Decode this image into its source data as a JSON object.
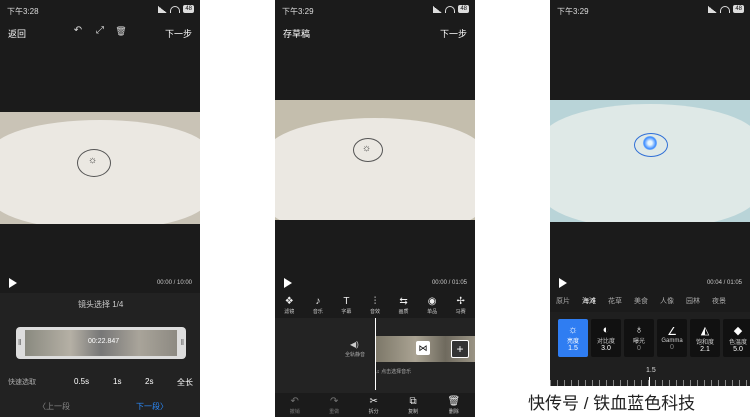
{
  "status": {
    "time1": "下午3:28",
    "time2": "下午3:29",
    "time3": "下午3:29",
    "battery": "48"
  },
  "p1": {
    "back": "返回",
    "next": "下一步",
    "undo_icon": "↶",
    "expand_icon": "⤢",
    "trash_icon": "🗑",
    "timecode": "00:00 / 10:00",
    "clip_label": "镜头选择 1/4",
    "overlay_time": "00:22.847",
    "quick_label": "快速选取",
    "durations": [
      "0.5s",
      "1s",
      "2s",
      "全长"
    ],
    "prev": "上一段",
    "nextseg": "下一段"
  },
  "p2": {
    "draft": "存草稿",
    "next": "下一步",
    "timecode": "00:00 / 01:05",
    "tools": [
      {
        "icon": "filter-icon",
        "glyph": "❖",
        "label": "滤镜"
      },
      {
        "icon": "music-icon",
        "glyph": "♪",
        "label": "音乐"
      },
      {
        "icon": "text-icon",
        "glyph": "T",
        "label": "字幕"
      },
      {
        "icon": "audio-icon",
        "glyph": "⫶",
        "label": "音效"
      },
      {
        "icon": "transition-icon",
        "glyph": "⇆",
        "label": "画质"
      },
      {
        "icon": "sticker-icon",
        "glyph": "◉",
        "label": "单品"
      },
      {
        "icon": "more-icon",
        "glyph": "✢",
        "label": "马赛"
      }
    ],
    "mute_label": "全轨静音",
    "add_music": "点击选择音乐",
    "bottom": [
      {
        "glyph": "↶",
        "label": "撤销"
      },
      {
        "glyph": "↷",
        "label": "重做"
      },
      {
        "glyph": "✂",
        "label": "拆分"
      },
      {
        "glyph": "⧉",
        "label": "复制"
      },
      {
        "glyph": "🗑",
        "label": "删除"
      }
    ]
  },
  "p3": {
    "timecode": "00:04 / 01:05",
    "filters": [
      "原片",
      "海滩",
      "花草",
      "美食",
      "人像",
      "园林",
      "夜景"
    ],
    "adjust": [
      {
        "icon": "brightness-icon",
        "glyph": "☼",
        "label": "亮度",
        "value": "1.5"
      },
      {
        "icon": "contrast-icon",
        "glyph": "◐",
        "label": "对比度",
        "value": "3.0"
      },
      {
        "icon": "exposure-icon",
        "glyph": "♁",
        "label": "曝光",
        "value": "0"
      },
      {
        "icon": "gamma-icon",
        "glyph": "∠",
        "label": "Gamma",
        "value": "0"
      },
      {
        "icon": "saturation-icon",
        "glyph": "◭",
        "label": "饱和度",
        "value": "2.1"
      },
      {
        "icon": "color-temp-icon",
        "glyph": "◆",
        "label": "色温度",
        "value": "5.0"
      }
    ],
    "slider_value": "1.5"
  },
  "caption": "快传号 / 铁血蓝色科技"
}
